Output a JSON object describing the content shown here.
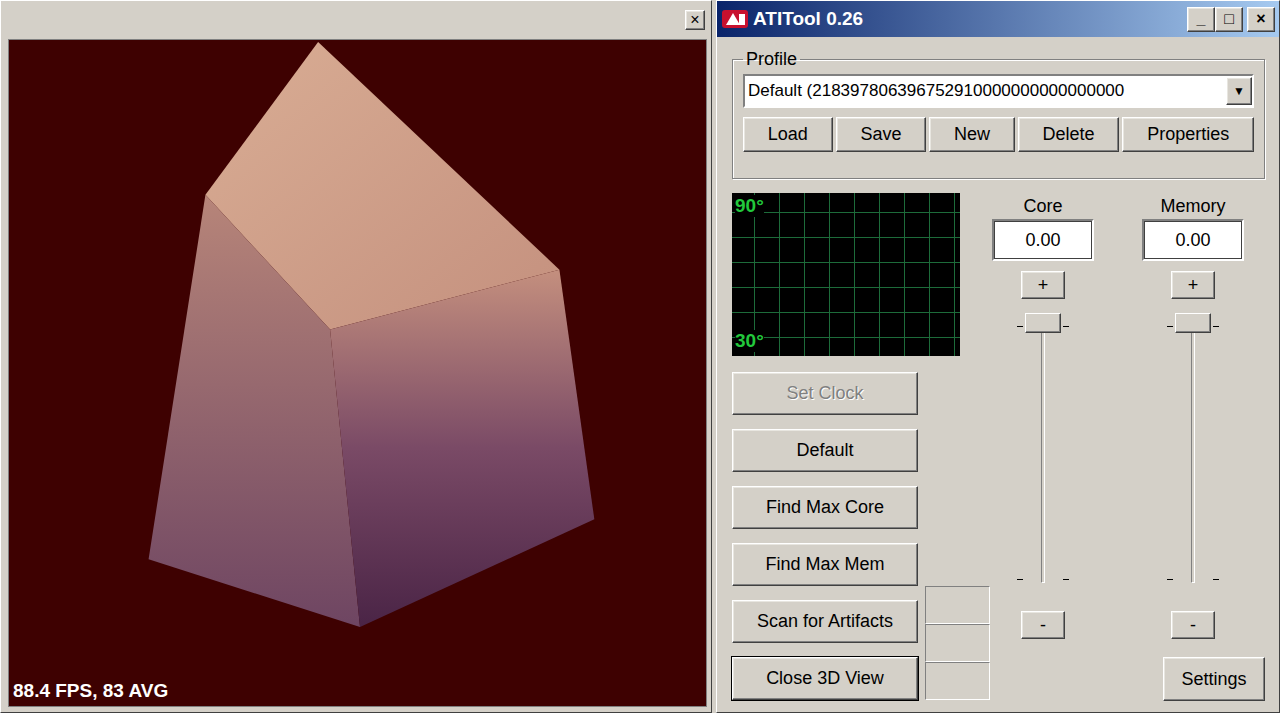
{
  "view_window": {
    "close_icon": "×",
    "fps": "88.4 FPS, 83 AVG"
  },
  "window": {
    "title": "ATITool 0.26",
    "controls": [
      "_",
      "□",
      "×"
    ]
  },
  "profile": {
    "label": "Profile",
    "value": "Default (218397806396752910000000000000000",
    "dropdown_icon": "▼",
    "buttons": [
      "Load",
      "Save",
      "New",
      "Delete",
      "Properties"
    ]
  },
  "temperature_graph": {
    "max_label": "90°",
    "min_label": "30°"
  },
  "actions": [
    {
      "label": "Set Clock",
      "disabled": true,
      "default": false
    },
    {
      "label": "Default",
      "disabled": false,
      "default": false
    },
    {
      "label": "Find Max Core",
      "disabled": false,
      "default": false
    },
    {
      "label": "Find Max Mem",
      "disabled": false,
      "default": false
    },
    {
      "label": "Scan for Artifacts",
      "disabled": false,
      "default": false
    },
    {
      "label": "Close 3D View",
      "disabled": false,
      "default": true
    }
  ],
  "clocks": [
    {
      "name": "Core",
      "value": "0.00",
      "plus": "+",
      "minus": "-",
      "level": 0
    },
    {
      "name": "Memory",
      "value": "0.00",
      "plus": "+",
      "minus": "-",
      "level": 0
    }
  ],
  "settings_button": "Settings"
}
